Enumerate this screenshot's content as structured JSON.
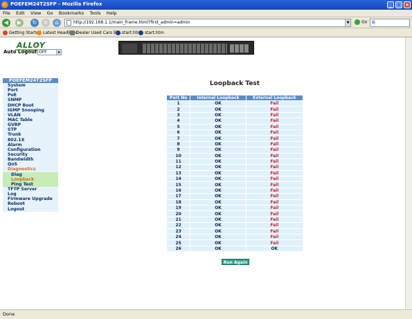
{
  "window": {
    "title": "POEFEM24T2SFP - Mozilla Firefox"
  },
  "menubar": [
    "File",
    "Edit",
    "View",
    "Go",
    "Bookmarks",
    "Tools",
    "Help"
  ],
  "navbar": {
    "url": "http://192.168.1.1/main_frame.html?first_admin=admin",
    "go_label": "Go"
  },
  "bookmarks": [
    "Getting Started",
    "Latest Headlines",
    "Dealer Used Cars Es...",
    "start.htm",
    "start.htm"
  ],
  "header": {
    "logo": "ALLOY",
    "autologout_label": "Auto Logout",
    "autologout_value": "OFF"
  },
  "sidebar": {
    "title": "POEFEM24T2SFP",
    "items": [
      {
        "label": "System"
      },
      {
        "label": "Port"
      },
      {
        "label": "PoE"
      },
      {
        "label": "SNMP"
      },
      {
        "label": "DHCP Boot"
      },
      {
        "label": "IGMP Snooping"
      },
      {
        "label": "VLAN"
      },
      {
        "label": "MAC Table"
      },
      {
        "label": "GVRP"
      },
      {
        "label": "STP"
      },
      {
        "label": "Trunk"
      },
      {
        "label": "802.1X"
      },
      {
        "label": "Alarm"
      },
      {
        "label": "Configuration"
      },
      {
        "label": "Security"
      },
      {
        "label": "Bandwidth"
      },
      {
        "label": "QoS"
      },
      {
        "label": "Diagnostics"
      }
    ],
    "sub_items": [
      {
        "label": "Diag"
      },
      {
        "label": "Loopback"
      },
      {
        "label": "Ping Test"
      }
    ],
    "items_after": [
      {
        "label": "TFTP Server"
      },
      {
        "label": "Log"
      },
      {
        "label": "Firmware Upgrade"
      },
      {
        "label": "Reboot"
      },
      {
        "label": "Logout"
      }
    ]
  },
  "main": {
    "title": "Loopback Test",
    "columns": [
      "Port No",
      "Internal Loopback",
      "External Loopback"
    ],
    "rows": [
      [
        "1",
        "OK",
        "Fail"
      ],
      [
        "2",
        "OK",
        "Fail"
      ],
      [
        "3",
        "OK",
        "Fail"
      ],
      [
        "4",
        "OK",
        "Fail"
      ],
      [
        "5",
        "OK",
        "Fail"
      ],
      [
        "6",
        "OK",
        "Fail"
      ],
      [
        "7",
        "OK",
        "Fail"
      ],
      [
        "8",
        "OK",
        "Fail"
      ],
      [
        "9",
        "OK",
        "Fail"
      ],
      [
        "10",
        "OK",
        "Fail"
      ],
      [
        "11",
        "OK",
        "Fail"
      ],
      [
        "12",
        "OK",
        "Fail"
      ],
      [
        "13",
        "OK",
        "Fail"
      ],
      [
        "14",
        "OK",
        "Fail"
      ],
      [
        "15",
        "OK",
        "Fail"
      ],
      [
        "16",
        "OK",
        "Fail"
      ],
      [
        "17",
        "OK",
        "Fail"
      ],
      [
        "18",
        "OK",
        "Fail"
      ],
      [
        "19",
        "OK",
        "Fail"
      ],
      [
        "20",
        "OK",
        "Fail"
      ],
      [
        "21",
        "OK",
        "Fail"
      ],
      [
        "22",
        "OK",
        "Fail"
      ],
      [
        "23",
        "OK",
        "Fail"
      ],
      [
        "24",
        "OK",
        "Fail"
      ],
      [
        "25",
        "OK",
        "Fail"
      ],
      [
        "26",
        "OK",
        "OK"
      ]
    ],
    "run_again_label": "Run Again"
  },
  "status": {
    "text": "Done"
  },
  "colors": {
    "fail": "#d21b2a",
    "header": "#5a8dc6",
    "cell": "#dff1fb",
    "highlight": "#d2691e",
    "sub_bg": "#c8ecb7"
  }
}
